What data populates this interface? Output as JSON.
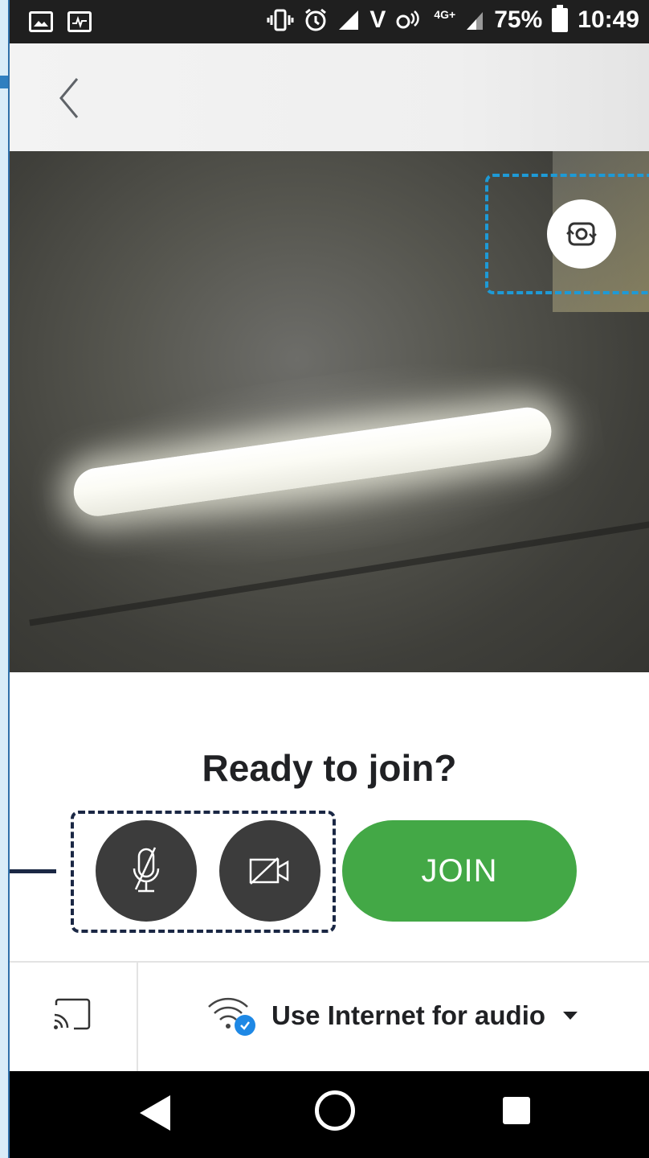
{
  "status_bar": {
    "battery": "75%",
    "time": "10:49",
    "network_type": "4G+",
    "carrier_label": "V",
    "icons": [
      "image-icon",
      "activity-icon",
      "vibrate-icon",
      "alarm-icon",
      "signal-icon",
      "volte-icon",
      "battery-icon"
    ]
  },
  "header": {
    "back_icon": "chevron-left-icon"
  },
  "preview": {
    "switch_camera_icon": "switch-camera-icon"
  },
  "prejoin": {
    "title": "Ready to join?",
    "mic_icon": "mic-off-icon",
    "camera_icon": "camera-off-icon",
    "join_label": "JOIN"
  },
  "audio": {
    "cast_icon": "cast-icon",
    "wifi_icon": "wifi-check-icon",
    "option_label": "Use Internet for audio",
    "dropdown_icon": "caret-down-icon"
  },
  "colors": {
    "join_green": "#43A846",
    "control_dark": "#3C3C3C",
    "highlight_blue": "#1E9AD6",
    "highlight_navy": "#1A2744"
  },
  "nav_bar": {
    "icons": [
      "nav-back-icon",
      "nav-home-icon",
      "nav-recents-icon"
    ]
  }
}
